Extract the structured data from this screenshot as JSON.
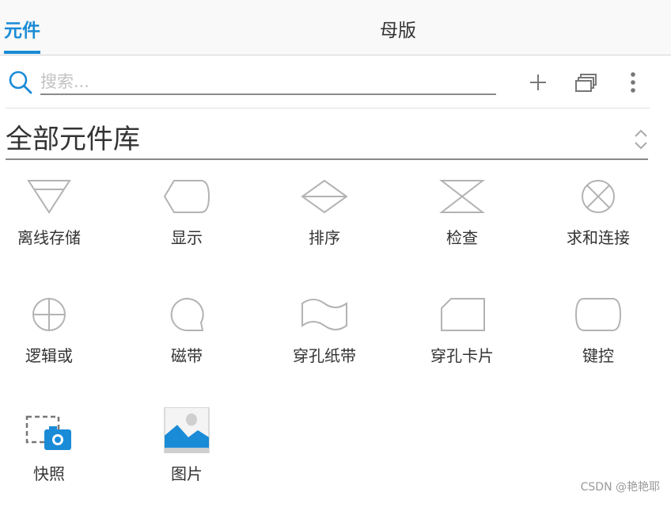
{
  "tabs": {
    "active": "元件",
    "inactive": "母版"
  },
  "search": {
    "placeholder": "搜索..."
  },
  "library": {
    "selected": "全部元件库"
  },
  "widgets": [
    {
      "label": "离线存储",
      "icon": "offline-storage-icon"
    },
    {
      "label": "显示",
      "icon": "display-icon"
    },
    {
      "label": "排序",
      "icon": "sort-icon"
    },
    {
      "label": "检查",
      "icon": "collate-icon"
    },
    {
      "label": "求和连接",
      "icon": "summing-junction-icon"
    },
    {
      "label": "逻辑或",
      "icon": "logical-or-icon"
    },
    {
      "label": "磁带",
      "icon": "tape-icon"
    },
    {
      "label": "穿孔纸带",
      "icon": "punched-tape-icon"
    },
    {
      "label": "穿孔卡片",
      "icon": "punched-card-icon"
    },
    {
      "label": "键控",
      "icon": "manual-input-icon"
    },
    {
      "label": "快照",
      "icon": "snapshot-icon"
    },
    {
      "label": "图片",
      "icon": "image-icon"
    }
  ],
  "watermark": "CSDN @艳艳耶",
  "colors": {
    "accent": "#1a8bd6",
    "icon_stroke": "#b3b3b3",
    "text": "#333333"
  }
}
